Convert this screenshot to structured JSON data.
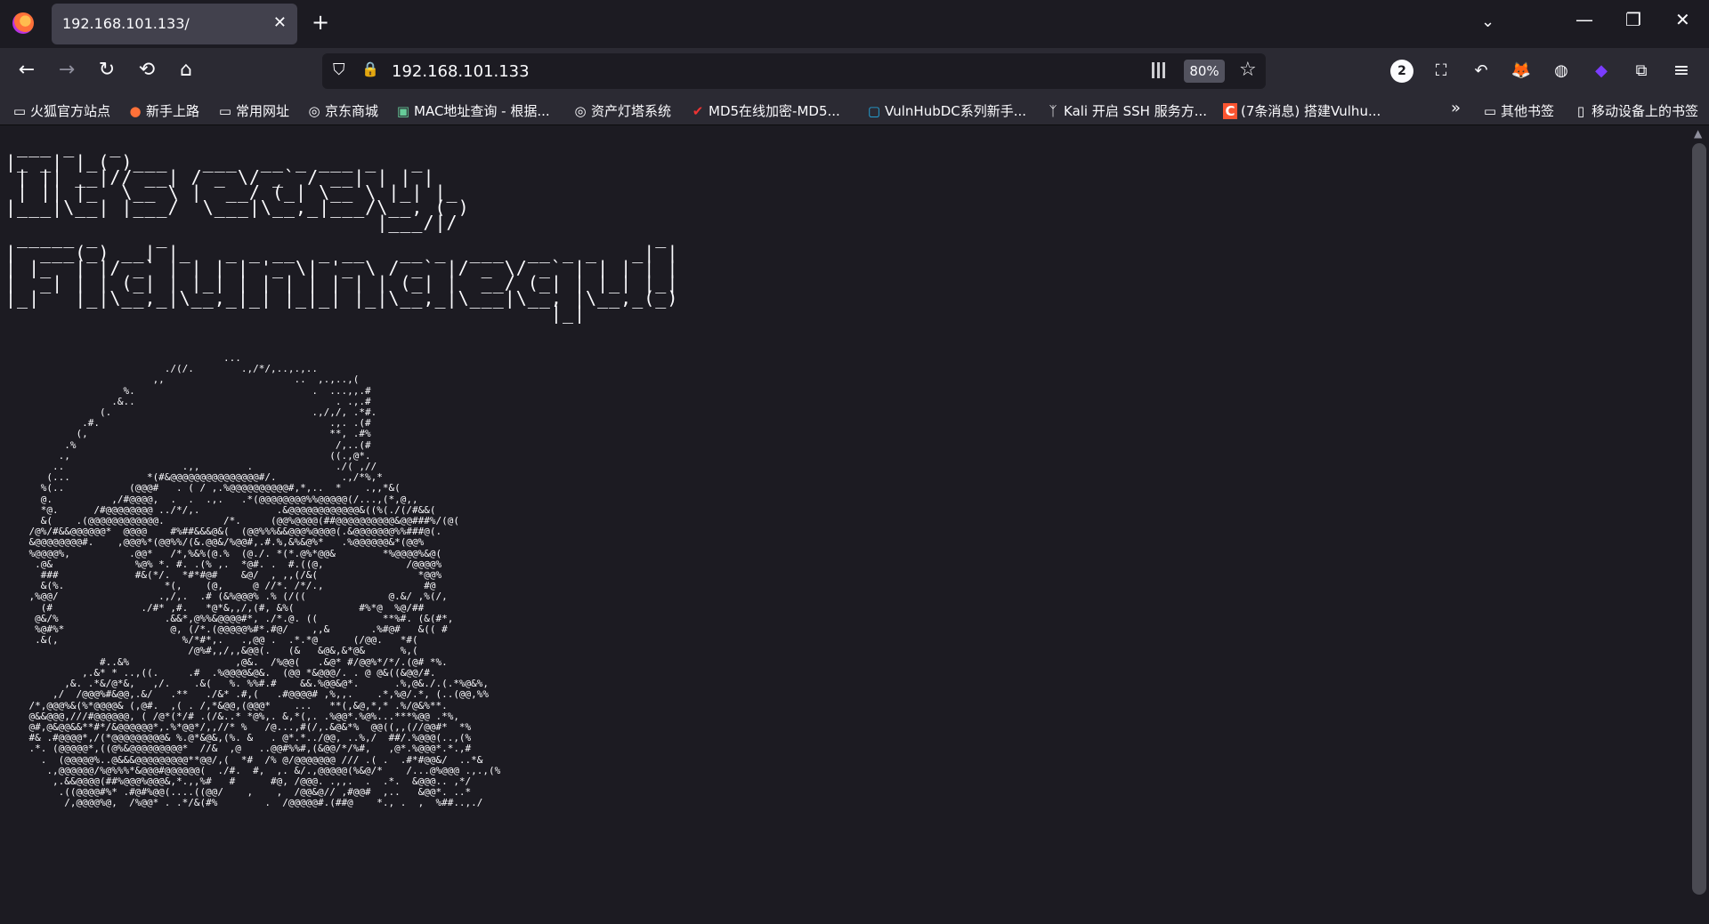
{
  "tab": {
    "title": "192.168.101.133/",
    "close": "✕",
    "new": "+"
  },
  "window": {
    "list": "⌄",
    "minimize": "—",
    "restore": "❐",
    "close": "✕"
  },
  "nav": {
    "back": "←",
    "forward": "→",
    "reload": "↻",
    "history": "⟲",
    "home": "⌂"
  },
  "urlbar": {
    "url": "192.168.101.133",
    "zoom": "80%",
    "shield": "⛉",
    "lock": "🔒",
    "star": "☆"
  },
  "extensions": {
    "badge": "2",
    "crop": "⛶",
    "undo": "↶",
    "fox": "🦊",
    "cookie": "◍",
    "gem": "◆",
    "puzzle": "⧉",
    "menu": "≡"
  },
  "bookmarks": [
    {
      "label": "火狐官方站点",
      "icon": "folder-icon"
    },
    {
      "label": "新手上路",
      "icon": "firefox-icon"
    },
    {
      "label": "常用网址",
      "icon": "folder-icon"
    },
    {
      "label": "京东商城",
      "icon": "globe-icon"
    },
    {
      "label": "MAC地址查询 - 根据...",
      "icon": "image-icon"
    },
    {
      "label": "资产灯塔系统",
      "icon": "globe-icon"
    },
    {
      "label": "MD5在线加密-MD5...",
      "icon": "check-icon"
    },
    {
      "label": "VulnHubDC系列新手...",
      "icon": "bilibili-icon"
    },
    {
      "label": "Kali 开启 SSH 服务方...",
      "icon": "kali-icon"
    },
    {
      "label": "(7条消息) 搭建Vulhu...",
      "icon": "csdn-icon"
    }
  ],
  "bookmarks_overflow": "»",
  "other_bookmarks": {
    "label": "其他书签",
    "icon": "folder-icon"
  },
  "mobile_bookmarks": {
    "label": "移动设备上的书签",
    "icon": "mobile-icon"
  },
  "content": {
    "banner": " ___ _   _  \n|_ _| |_( )___   ___  __ _ ___ _   _ \n | || __|// __| / _ \\/ _` / __| | | |\n | || |_  \\__ \\ |  __/ (_| \\__ \\ |_| |_ \n|___|\\__| |___/  \\___|\\__,_|___/\\__, ( )\n                                |___/|/ \n _____ _     _                                          _\n|  ___(_) __| |_   _ _ __  _ __   __ _  ___  __ _ _   _| |\n| |_  | |/ _` | | | | '_ \\| '_ \\ / _` |/ _ \\/ _` | | | | |\n|  _| | | (_| | |_| | | | | | | | (_| |  __/ (_| | |_| |_|\n|_|   |_|\\__,_|\\__,_|_| |_|_| |_|\\__,_|\\___|\\__, |\\__,_(_)\n                                               |_|",
    "face": "                                     ...\n                           ./(/.        .,/*/,..,.,..\n                         ,,                      ..  ,.,..,(\n                    %.                              .  ...,,.#\n                  .&..                                  . .,.#\n                (.                                  .,/,/, .*#.\n             .#.                                       .,. .(#\n            (,                                         **, .#%\n          .%                                            /,..(#\n         .,                                            ((.,@*.\n        ..                    .,,        .              ./( ,//\n       (...             *(#&@@@@@@@@@@@@@@@#/.           .,/*%,*\n      %(..           (@@@#   . ( / ,.%@@@@@@@@@@#,*,..  *    .,,*&(\n      @.          ,/#@@@@,  .  .  .,.   .*(@@@@@@@@%%@@@@@(/...,(*,@,,\n      *@.      /#@@@@@@@@ ../*/,.             .&@@@@@@@@@@@@&((%(./(/#&&(\n      &(    .(@@@@@@@@@@@@.          /*.     (@@%@@@@(##@@@@@@@@@@&@@###%/(@(\n    /@%/#&&@@@@@@*  @@@@    #%##&&&@&(  (@@%%%&&@@@%@@@@(.&@@@@@@@%%###@(.\n    &@@@@@@@@#.    ,@@@%*(@@%%/(&.@@&/%@@#,.#.%,&%&@%*   .%@@@@@@&*(@@%\n    %@@@@%,          .@@*   /*,%&%(@.%  (@./. *(*.@%*@@&        *%@@@@%&@(\n     .@&              %@% *. #. .(% ,.  *@#. .  #.((@,              /@@@@%\n      ###             #&(*/.  *#*#@#    &@/  , ,,(/&(                 *@@%\n      &(%.                 *(,    (@,     @ //*. /*/.,                 #@\n    ,%@@/                 .,/,.  .# (&%@@@% .% (/((              @.&/ ,%(/,\n      (#               ./#* ,#.   *@*&,,/,(#, &%(           #%*@  %@/##\n     @&/%                  .&&*,@%%&@@@@#*, ./*.@. ((           **%#. (&(#*,\n     %@#%*                  @, (/*.(@@@@@%#*.#@/    ,,&       .%#@#   &(( #\n     .&(,                     %/*#*,.   .,@@ .  .*.*@      (/@@.   *#(\n                               /@%#,,/,,&@@(.   (&   &@&,&*@&      %,(\n                #..&%                  ,@&.  /%@@(   .&@* #/@@%*/*/.(@# *%.\n             ,.&* * ..,((.     .#  .%@@@@&@&.  (@@ *&@@@/. . @ @&((&@@/#.\n          ,&. .*&/@*&,   ,/.    .&(   %. %%#.#    &&.%@@&@*.      .%,@&./.(.*%@&%,\n        ,/  /@@@%#&@@,.&/   .**   ./&* .#,(   .#@@@@# ,%,,.    .*,%@/.*, (..(@@,%%\n    /*,@@@%&(%*@@@@& (,@#.  ,( . /,*&@@,(@@@*    ...   **(,&@,*,* .%/@&%**.\n    @&&@@@,///#@@@@@@, ( /@*(*/# .(/&..* *@%,. &,*(,. .%@@*.%@%...***%@@ .*%,\n    @#,@&@@&&**#*/&@@@@@@*,.%*@@*/,,//* %   /@...,#(/,.&@&*%  @@((,,(//@@#*  *%\n    #& .#@@@@*,/(*@@@@@@@@@& %.@*&@&,(%. &   . @*.*../@@, ..%,/  ##/.%@@@(..,(%\n    .*. (@@@@@*,((@%&@@@@@@@@@*  //&  ,@   ..@@#%%#,(&@@/*/%#,   ,@*.%@@@*.*.,#\n      .  (@@@@@%..@&&&@@@@@@@@@**@@/,(  *#  /% @/@@@@@@@ /// .( .  .#*#@@&/  ..*&\n       .,@@@@@@/%@%%%*&@@@#@@@@@@(  ./#.  #,  ,. &/.,@@@@@(%&@/*    /...@%@@@ .,.,(%\n        ,.&&@@@@(##%@@@%@@@&,*.,,%#   #      #@, /@@@. .,,.  .  .*.  &@@@.. ,*/\n         .((@@@@#%* .#@#%@@(....((@@/    ,    ,  /@@&@// ,#@@#  ,..   &@@*. ..*\n          /,@@@@%@,  /%@@* . .*/&(#%        .  /@@@@@#.(##@    *., .  ,  %##..,./"
  }
}
